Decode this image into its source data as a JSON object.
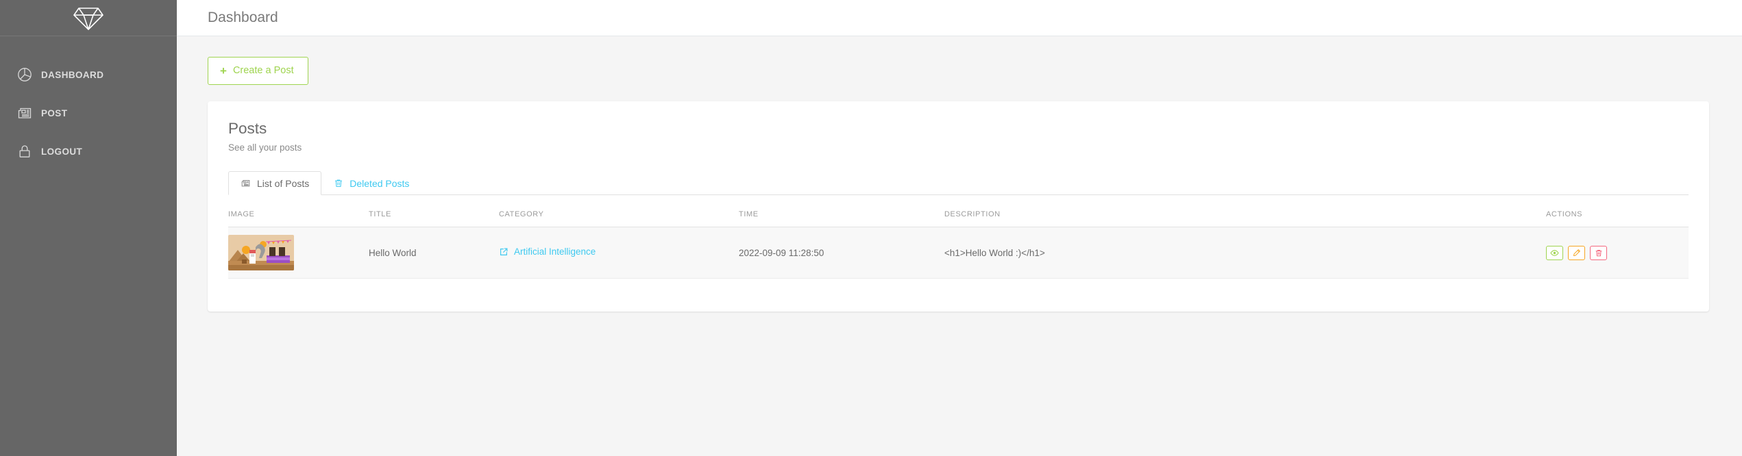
{
  "sidebar": {
    "brand": {
      "logo_icon": "diamond-icon"
    },
    "items": [
      {
        "label": "DASHBOARD",
        "icon": "pie-chart-icon"
      },
      {
        "label": "POST",
        "icon": "newspaper-icon"
      },
      {
        "label": "LOGOUT",
        "icon": "lock-icon"
      }
    ]
  },
  "topbar": {
    "title": "Dashboard"
  },
  "toolbar": {
    "create_label": "Create a Post",
    "create_plus": "+",
    "create_icon": "plus-icon"
  },
  "card": {
    "title": "Posts",
    "subtitle": "See all your posts"
  },
  "tabs": [
    {
      "label": "List of Posts",
      "icon": "newspaper-icon",
      "active": true
    },
    {
      "label": "Deleted Posts",
      "icon": "trash-icon",
      "active": false
    }
  ],
  "table": {
    "headers": [
      "IMAGE",
      "TITLE",
      "CATEGORY",
      "TIME",
      "DESCRIPTION",
      "ACTIONS"
    ],
    "rows": [
      {
        "image_icon": "post-thumbnail",
        "title": "Hello World",
        "category": "Artificial Intelligence",
        "category_icon": "external-link-icon",
        "time": "2022-09-09 11:28:50",
        "description": "<h1>Hello World :)</h1>",
        "actions": [
          {
            "name": "view",
            "icon": "eye-icon"
          },
          {
            "name": "edit",
            "icon": "pencil-icon"
          },
          {
            "name": "delete",
            "icon": "trash-icon"
          }
        ]
      }
    ]
  },
  "colors": {
    "sidebar_bg": "#666666",
    "accent_green": "#9fd450",
    "accent_cyan": "#3ec9f0",
    "accent_orange": "#f5a623",
    "accent_red": "#f4687f",
    "page_bg": "#f5f5f5"
  }
}
